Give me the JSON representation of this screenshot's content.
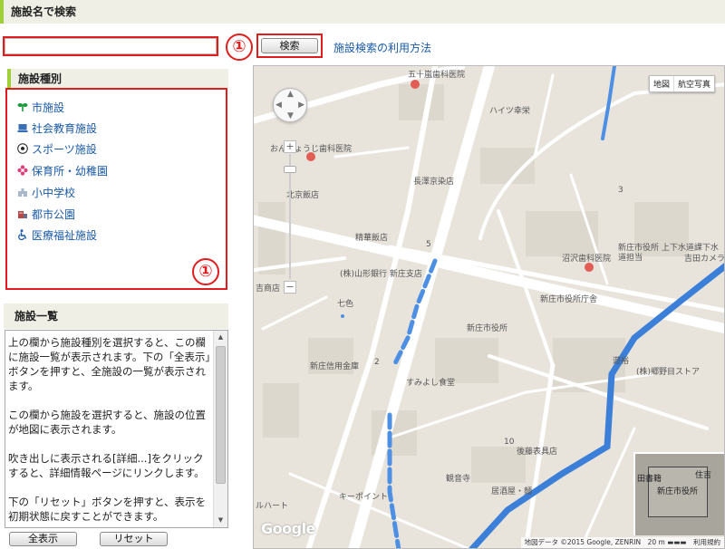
{
  "header": {
    "title": "施設名で検索"
  },
  "search": {
    "value": "",
    "placeholder": "",
    "button_label": "検索",
    "help_link": "施設検索の利用方法",
    "marker": "①"
  },
  "categories": {
    "title": "施設種別",
    "marker": "①",
    "items": [
      {
        "label": "市施設",
        "icon": "sprout-icon",
        "color": "#1a9a3a"
      },
      {
        "label": "社会教育施設",
        "icon": "computer-icon",
        "color": "#3a6fb8"
      },
      {
        "label": "スポーツ施設",
        "icon": "soccer-ball-icon",
        "color": "#222222"
      },
      {
        "label": "保育所・幼稚園",
        "icon": "flower-icon",
        "color": "#e0407a"
      },
      {
        "label": "小中学校",
        "icon": "school-icon",
        "color": "#8aa0b8"
      },
      {
        "label": "都市公園",
        "icon": "park-icon",
        "color": "#c05050"
      },
      {
        "label": "医療福祉施設",
        "icon": "wheelchair-icon",
        "color": "#1a5aa8"
      }
    ]
  },
  "facility_list": {
    "title": "施設一覧",
    "paragraphs": [
      "上の欄から施設種別を選択すると、この欄に施設一覧が表示されます。下の「全表示」ボタンを押すと、全施設の一覧が表示されます。",
      "この欄から施設を選択すると、施設の位置が地図に表示されます。",
      "吹き出しに表示される[詳細...]をクリックすると、詳細情報ページにリンクします。",
      "下の「リセット」ボタンを押すと、表示を初期状態に戻すことができます。"
    ]
  },
  "buttons": {
    "show_all": "全表示",
    "reset": "リセット"
  },
  "map": {
    "type_map": "地図",
    "type_satellite": "航空写真",
    "zoom_in": "+",
    "zoom_out": "−",
    "logo": "Google",
    "attribution": "地図データ ©2015 Google, ZENRIN　20 m ▬▬▬　利用規約",
    "labels": [
      "五十嵐歯科医院",
      "ハイツ幸栄",
      "おんじょうじ歯科医院",
      "長澤京染店",
      "北京飯店",
      "精華飯店",
      "沼沢歯科医院",
      "新庄市役所 上下水道課下水道担当",
      "吉田カメラ",
      "(株)山形銀行 新庄支店",
      "七色",
      "新庄市役所庁舎",
      "新庄市役所",
      "新庄信用金庫",
      "すみよし食堂",
      "遊裕",
      "(株)郷野目ストア",
      "後藤表具店",
      "観音寺",
      "居酒屋・麺",
      "キーポイント",
      "ルハート",
      "吉商店",
      "新庄市役所",
      "住吉",
      "3",
      "5",
      "2",
      "10",
      "田書籍"
    ]
  }
}
